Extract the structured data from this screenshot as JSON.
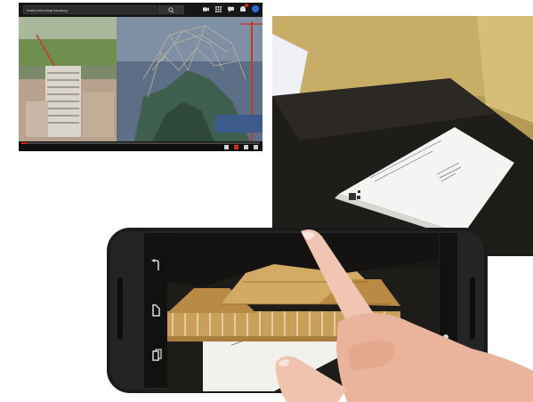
{
  "player": {
    "search_text": "Institut teknologi bandung",
    "overlay_text": "",
    "progress": 0.02,
    "icons": [
      "camera-icon",
      "apps-grid-icon",
      "chat-icon",
      "bell-icon",
      "avatar-icon"
    ]
  },
  "colors": {
    "yt_red": "#e62117",
    "paper": "#f4f4f2",
    "phone": "#1b1b1b",
    "roof_gold": "#c9a05a"
  },
  "document": {
    "title_lines": [
      "",
      ""
    ],
    "side_lines": [
      "",
      "",
      ""
    ]
  },
  "phone": {
    "nav_icons": [
      "back-icon",
      "home-icon",
      "recents-icon"
    ],
    "side_icons": [
      "record-icon",
      "camera-switch-icon"
    ]
  }
}
